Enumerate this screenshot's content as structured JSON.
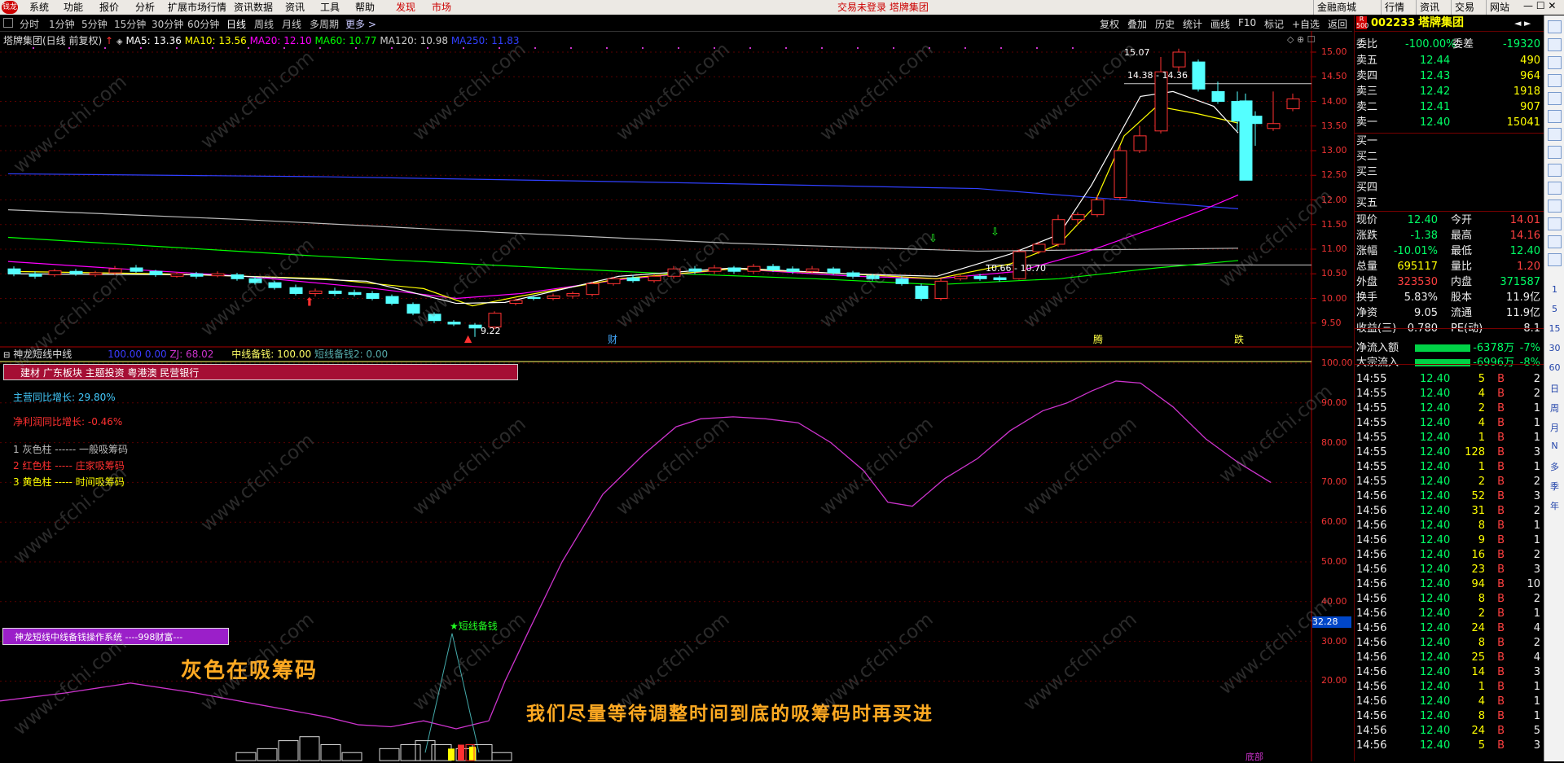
{
  "menu": {
    "logo": "钱龙",
    "items": [
      "系统",
      "功能",
      "报价",
      "分析",
      "扩展市场行情",
      "资讯数据",
      "资讯",
      "工具",
      "帮助"
    ],
    "highlight": [
      "发现",
      "市场"
    ],
    "center_text": "交易未登录  塔牌集团",
    "right_items": [
      "金融商城",
      "行情",
      "资讯",
      "交易",
      "网站"
    ]
  },
  "periods": [
    "分时",
    "1分钟",
    "5分钟",
    "15分钟",
    "30分钟",
    "60分钟",
    "日线",
    "周线",
    "月线",
    "多周期"
  ],
  "periods_more": "更多 >",
  "toolbar": [
    "复权",
    "叠加",
    "历史",
    "统计",
    "画线",
    "F10",
    "标记",
    "+自选",
    "返回"
  ],
  "chart_header": {
    "title": "塔牌集团(日线 前复权)",
    "ma5": "MA5: 13.36",
    "ma10": "MA10: 13.56",
    "ma20": "MA20: 12.10",
    "ma60": "MA60: 10.77",
    "ma120": "MA120: 10.98",
    "ma250": "MA250: 11.83"
  },
  "main_axis": [
    "15.00",
    "14.50",
    "14.00",
    "13.50",
    "13.00",
    "12.50",
    "12.00",
    "11.50",
    "11.00",
    "10.50",
    "10.00",
    "9.50"
  ],
  "annotations": {
    "high": "15.07",
    "range": "14.38 - 14.36",
    "low": "9.22",
    "mid_range": "10.66 - 10.70",
    "tag_cai": "财",
    "tag_teng": "腾",
    "tag_die": "跌"
  },
  "indicator_header": {
    "name": "神龙短线中线",
    "v1": "100.00",
    "v2": "0.00",
    "zj": "ZJ: 68.02",
    "mid_label": "中线备钱: 100.00",
    "short_label": "短线备钱2: 0.00"
  },
  "indicator_axis": [
    "100.00",
    "90.00",
    "80.00",
    "70.00",
    "60.00",
    "50.00",
    "40.00",
    "30.00",
    "20.00"
  ],
  "indicator_current": "32.28",
  "sector_box": "建材 广东板块 主题投资 粤港澳 民营银行",
  "stats": {
    "main_growth_label": "主营同比增长: ",
    "main_growth": "29.80%",
    "profit_growth_label": "净利润同比增长: ",
    "profit_growth": "-0.46%"
  },
  "legend": [
    {
      "text": "1 灰色柱 ------ 一般吸筹码",
      "color": "#bbbbbb"
    },
    {
      "text": "2 红色柱 ----- 庄家吸筹码",
      "color": "#ff3030"
    },
    {
      "text": "3 黄色柱 ----- 时间吸筹码",
      "color": "#ffff00"
    }
  ],
  "system_box": "神龙短线中线备钱操作系统 ----998财富---",
  "star_label": "★短线备钱",
  "caption_left": "灰色在吸筹码",
  "caption_main": "我们尽量等待调整时间到底的吸筹码时再买进",
  "bottom_tag": "底部",
  "watermark": "www.cfchi.com",
  "stock": {
    "code": "002233",
    "name": "塔牌集团",
    "badge": "R 500"
  },
  "orderbook": {
    "weibi_label": "委比",
    "weibi": "-100.00%",
    "weicha_label": "委差",
    "weicha": "-19320",
    "asks": [
      {
        "label": "卖五",
        "price": "12.44",
        "vol": "490"
      },
      {
        "label": "卖四",
        "price": "12.43",
        "vol": "964"
      },
      {
        "label": "卖三",
        "price": "12.42",
        "vol": "1918"
      },
      {
        "label": "卖二",
        "price": "12.41",
        "vol": "907"
      },
      {
        "label": "卖一",
        "price": "12.40",
        "vol": "15041"
      }
    ],
    "bids": [
      "买一",
      "买二",
      "买三",
      "买四",
      "买五"
    ]
  },
  "quote": [
    {
      "l1": "现价",
      "v1": "12.40",
      "c1": "grn",
      "l2": "今开",
      "v2": "14.01",
      "c2": "red"
    },
    {
      "l1": "涨跌",
      "v1": "-1.38",
      "c1": "grn",
      "l2": "最高",
      "v2": "14.16",
      "c2": "red"
    },
    {
      "l1": "涨幅",
      "v1": "-10.01%",
      "c1": "grn",
      "l2": "最低",
      "v2": "12.40",
      "c2": "grn"
    },
    {
      "l1": "总量",
      "v1": "695117",
      "c1": "yel",
      "l2": "量比",
      "v2": "1.20",
      "c2": "red"
    },
    {
      "l1": "外盘",
      "v1": "323530",
      "c1": "red",
      "l2": "内盘",
      "v2": "371587",
      "c2": "grn"
    },
    {
      "l1": "换手",
      "v1": "5.83%",
      "c1": "wht",
      "l2": "股本",
      "v2": "11.9亿",
      "c2": "wht"
    },
    {
      "l1": "净资",
      "v1": "9.05",
      "c1": "wht",
      "l2": "流通",
      "v2": "11.9亿",
      "c2": "wht"
    },
    {
      "l1": "收益(三)",
      "v1": "0.780",
      "c1": "wht",
      "l2": "PE(动)",
      "v2": "8.1",
      "c2": "wht"
    }
  ],
  "flows": [
    {
      "label": "净流入额",
      "value": "-6378万",
      "pct": "-7%"
    },
    {
      "label": "大宗流入",
      "value": "-6996万",
      "pct": "-8%"
    }
  ],
  "ticks": [
    {
      "t": "14:55",
      "p": "12.40",
      "v": "5",
      "d": "B",
      "n": "2"
    },
    {
      "t": "14:55",
      "p": "12.40",
      "v": "4",
      "d": "B",
      "n": "2"
    },
    {
      "t": "14:55",
      "p": "12.40",
      "v": "2",
      "d": "B",
      "n": "1"
    },
    {
      "t": "14:55",
      "p": "12.40",
      "v": "4",
      "d": "B",
      "n": "1"
    },
    {
      "t": "14:55",
      "p": "12.40",
      "v": "1",
      "d": "B",
      "n": "1"
    },
    {
      "t": "14:55",
      "p": "12.40",
      "v": "128",
      "d": "B",
      "n": "3"
    },
    {
      "t": "14:55",
      "p": "12.40",
      "v": "1",
      "d": "B",
      "n": "1"
    },
    {
      "t": "14:55",
      "p": "12.40",
      "v": "2",
      "d": "B",
      "n": "2"
    },
    {
      "t": "14:56",
      "p": "12.40",
      "v": "52",
      "d": "B",
      "n": "3"
    },
    {
      "t": "14:56",
      "p": "12.40",
      "v": "31",
      "d": "B",
      "n": "2"
    },
    {
      "t": "14:56",
      "p": "12.40",
      "v": "8",
      "d": "B",
      "n": "1"
    },
    {
      "t": "14:56",
      "p": "12.40",
      "v": "9",
      "d": "B",
      "n": "1"
    },
    {
      "t": "14:56",
      "p": "12.40",
      "v": "16",
      "d": "B",
      "n": "2"
    },
    {
      "t": "14:56",
      "p": "12.40",
      "v": "23",
      "d": "B",
      "n": "3"
    },
    {
      "t": "14:56",
      "p": "12.40",
      "v": "94",
      "d": "B",
      "n": "10"
    },
    {
      "t": "14:56",
      "p": "12.40",
      "v": "8",
      "d": "B",
      "n": "2"
    },
    {
      "t": "14:56",
      "p": "12.40",
      "v": "2",
      "d": "B",
      "n": "1"
    },
    {
      "t": "14:56",
      "p": "12.40",
      "v": "24",
      "d": "B",
      "n": "4"
    },
    {
      "t": "14:56",
      "p": "12.40",
      "v": "8",
      "d": "B",
      "n": "2"
    },
    {
      "t": "14:56",
      "p": "12.40",
      "v": "25",
      "d": "B",
      "n": "4"
    },
    {
      "t": "14:56",
      "p": "12.40",
      "v": "14",
      "d": "B",
      "n": "3"
    },
    {
      "t": "14:56",
      "p": "12.40",
      "v": "1",
      "d": "B",
      "n": "1"
    },
    {
      "t": "14:56",
      "p": "12.40",
      "v": "4",
      "d": "B",
      "n": "1"
    },
    {
      "t": "14:56",
      "p": "12.40",
      "v": "8",
      "d": "B",
      "n": "1"
    },
    {
      "t": "14:56",
      "p": "12.40",
      "v": "24",
      "d": "B",
      "n": "5"
    },
    {
      "t": "14:56",
      "p": "12.40",
      "v": "5",
      "d": "B",
      "n": "3"
    }
  ],
  "side_strip": [
    "1",
    "5",
    "15",
    "30",
    "60",
    "日",
    "周",
    "月",
    "N",
    "多",
    "季",
    "年"
  ],
  "colors": {
    "up": "#ff3232",
    "down": "#54ffff",
    "ma5": "#ffffff",
    "ma10": "#ffff00",
    "ma20": "#ff00ff",
    "ma60": "#00ff00",
    "ma120": "#bbbbbb",
    "ma250": "#3040ff",
    "indicator": "#cc33cc"
  }
}
